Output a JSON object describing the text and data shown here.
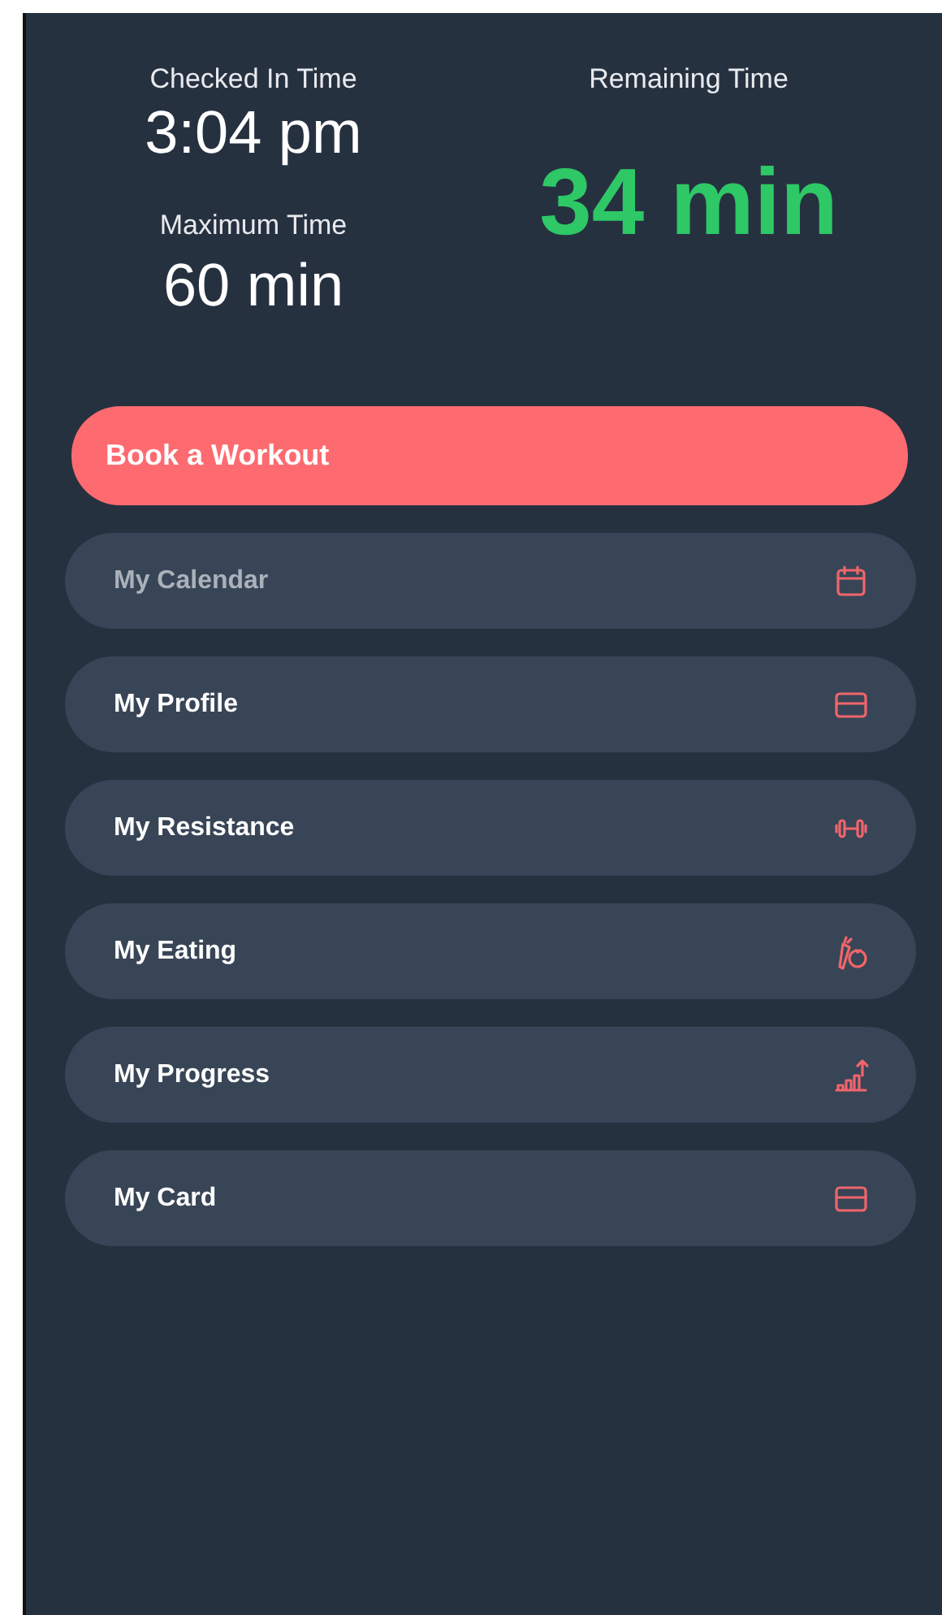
{
  "stats": {
    "checked_in": {
      "label": "Checked In Time",
      "value": "3:04 pm"
    },
    "maximum": {
      "label": "Maximum Time",
      "value": "60 min"
    },
    "remaining": {
      "label": "Remaining Time",
      "value": "34 min"
    }
  },
  "primary_button": "Book a Workout",
  "menu": [
    {
      "label": "My Calendar",
      "kind": "calendar",
      "disabled": true
    },
    {
      "label": "My Profile",
      "kind": "card",
      "disabled": false
    },
    {
      "label": "My Resistance",
      "kind": "dumbbell",
      "disabled": false
    },
    {
      "label": "My Eating",
      "kind": "food",
      "disabled": false
    },
    {
      "label": "My Progress",
      "kind": "growth",
      "disabled": false
    },
    {
      "label": "My Card",
      "kind": "card",
      "disabled": false
    }
  ]
}
